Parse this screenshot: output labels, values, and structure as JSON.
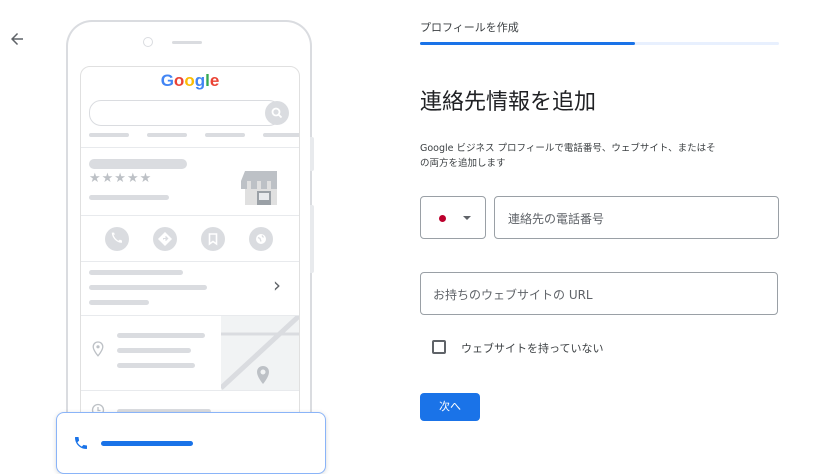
{
  "nav": {
    "back_icon": "arrow-left-icon"
  },
  "phone": {
    "logo_letters": [
      {
        "ch": "G",
        "color": "#4285f4"
      },
      {
        "ch": "o",
        "color": "#ea4335"
      },
      {
        "ch": "o",
        "color": "#fbbc05"
      },
      {
        "ch": "g",
        "color": "#4285f4"
      },
      {
        "ch": "l",
        "color": "#34a853"
      },
      {
        "ch": "e",
        "color": "#ea4335"
      }
    ],
    "rating_stars": "★★★★★",
    "search_icon": "search-icon",
    "action_icons": [
      "phone-icon",
      "directions-icon",
      "bookmark-icon",
      "website-icon"
    ],
    "chevron": "›"
  },
  "form": {
    "step_label": "プロフィールを作成",
    "progress": 0.6,
    "title": "連絡先情報を追加",
    "description_line1": "Google ビジネス プロフィールで電話番号、ウェブサイト、またはそ",
    "description_line2": "の両方を追加します",
    "phone_placeholder": "連絡先の電話番号",
    "website_placeholder": "お持ちのウェブサイトの URL",
    "no_website_label": "ウェブサイトを持っていない",
    "next_label": "次へ"
  },
  "colors": {
    "accent": "#1a73e8",
    "flag_red": "#bc002d",
    "border": "#9aa0a6"
  }
}
